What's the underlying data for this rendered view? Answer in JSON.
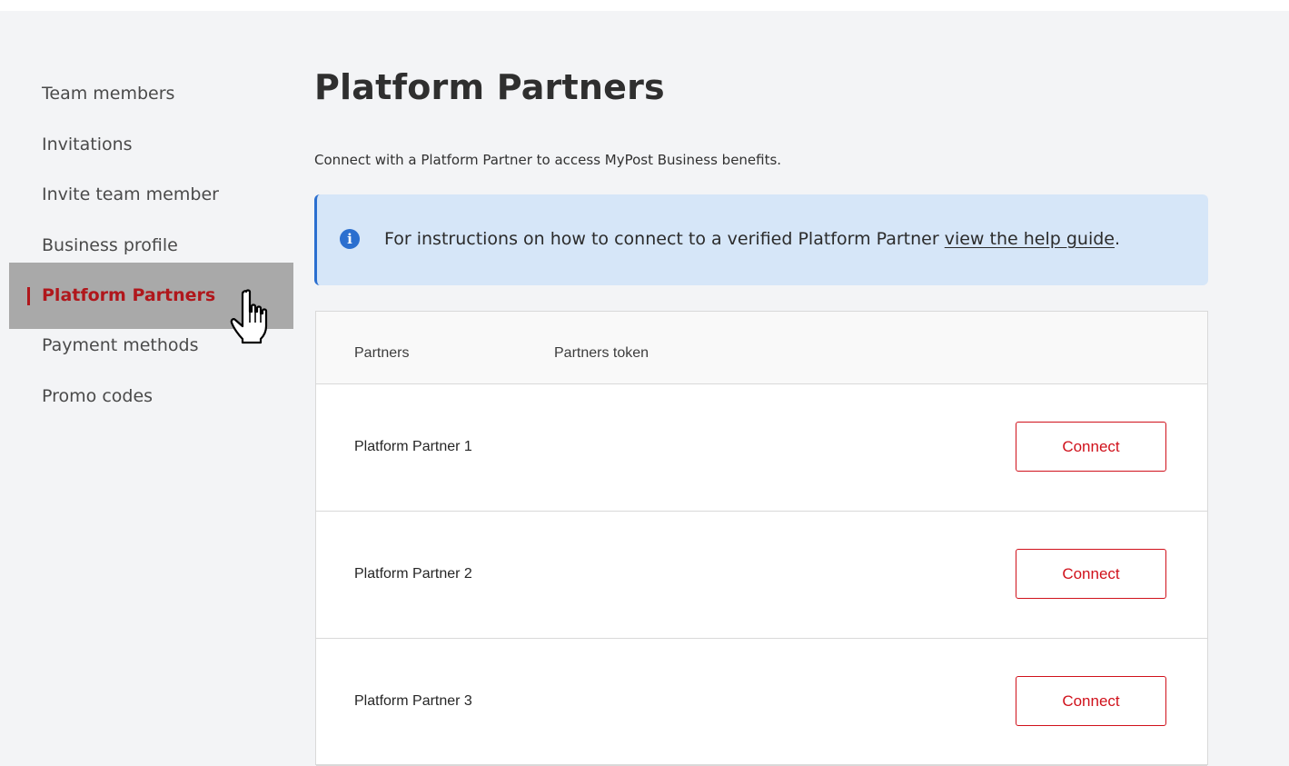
{
  "sidebar": {
    "items": [
      {
        "label": "Team members",
        "active": false
      },
      {
        "label": "Invitations",
        "active": false
      },
      {
        "label": "Invite team member",
        "active": false
      },
      {
        "label": "Business profile",
        "active": false
      },
      {
        "label": "Platform Partners",
        "active": true
      },
      {
        "label": "Payment methods",
        "active": false
      },
      {
        "label": "Promo codes",
        "active": false
      }
    ]
  },
  "main": {
    "title": "Platform Partners",
    "subtitle": "Connect with a Platform Partner to access MyPost Business benefits.",
    "banner": {
      "icon": "info-icon",
      "text": "For instructions on how to connect to a verified Platform Partner ",
      "link_text": "view the help guide",
      "trailing": "."
    },
    "table": {
      "headers": [
        "Partners",
        "Partners token"
      ],
      "rows": [
        {
          "name": "Platform Partner 1",
          "action": "Connect"
        },
        {
          "name": "Platform Partner 2",
          "action": "Connect"
        },
        {
          "name": "Platform Partner 3",
          "action": "Connect"
        }
      ]
    }
  },
  "colors": {
    "accent": "#d0111b",
    "active_nav": "#b0171c",
    "banner_bg": "#d6e6f8",
    "info_blue": "#2b6fcf",
    "page_bg": "#f3f4f6"
  }
}
